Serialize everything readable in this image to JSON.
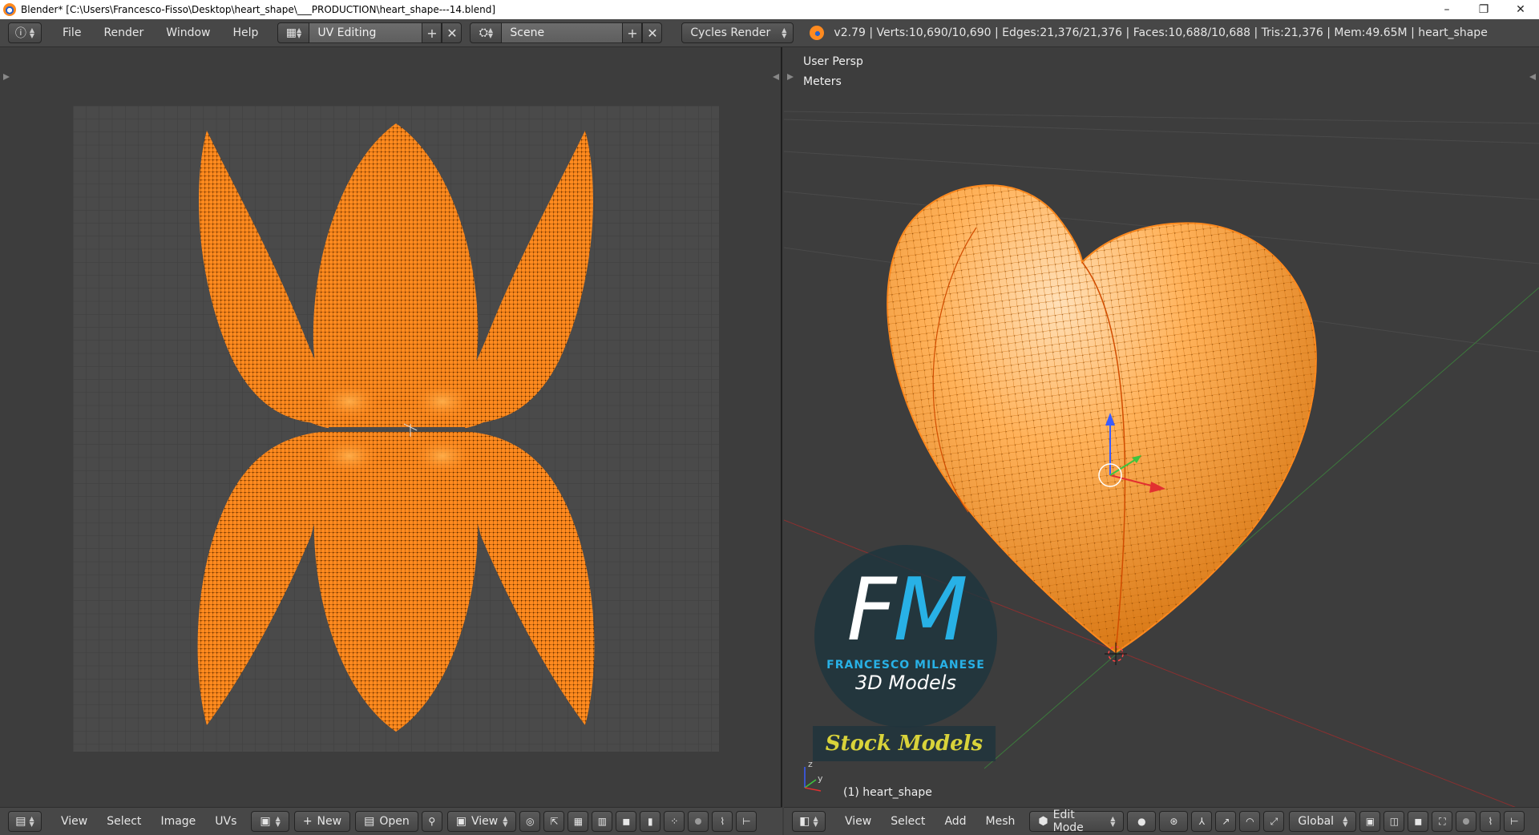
{
  "titlebar": {
    "title": "Blender* [C:\\Users\\Francesco-Fisso\\Desktop\\heart_shape\\___PRODUCTION\\heart_shape---14.blend]",
    "minimize": "–",
    "restore": "❐",
    "close": "✕"
  },
  "infobar": {
    "editor_icon": "ⓘ",
    "menu": [
      "File",
      "Render",
      "Window",
      "Help"
    ],
    "layout": {
      "icon": "▦",
      "value": "UV Editing",
      "add": "+",
      "remove": "✕"
    },
    "scene": {
      "icon": "⛭",
      "value": "Scene",
      "add": "+",
      "remove": "✕"
    },
    "render_engine": "Cycles Render",
    "stats": "v2.79 | Verts:10,690/10,690 | Edges:21,376/21,376 | Faces:10,688/10,688 | Tris:21,376 | Mem:49.65M | heart_shape"
  },
  "viewport": {
    "view_label": "User Persp",
    "units_label": "Meters",
    "object_label": "(1) heart_shape",
    "axis_y": "y",
    "axis_z": "z"
  },
  "watermark": {
    "initial_f": "F",
    "initial_m": "M",
    "name": "FRANCESCO MILANESE",
    "subtitle": "3D Models",
    "badge": "Stock Models"
  },
  "uv_footer": {
    "editor_icon": "▤",
    "menu": [
      "View",
      "Select",
      "Image",
      "UVs"
    ],
    "new_label": "New",
    "open_label": "Open",
    "view_label": "View"
  },
  "vp_footer": {
    "editor_icon": "◧",
    "menu": [
      "View",
      "Select",
      "Add",
      "Mesh"
    ],
    "mode_label": "Edit Mode",
    "orientation_label": "Global"
  },
  "colors": {
    "mesh_orange": "#ff8a1f",
    "wire_dark": "#b85a00",
    "background": "#3d3d3d",
    "header": "#474747",
    "watermark_blue": "#28b1e6",
    "badge_yellow": "#d9d33a"
  }
}
